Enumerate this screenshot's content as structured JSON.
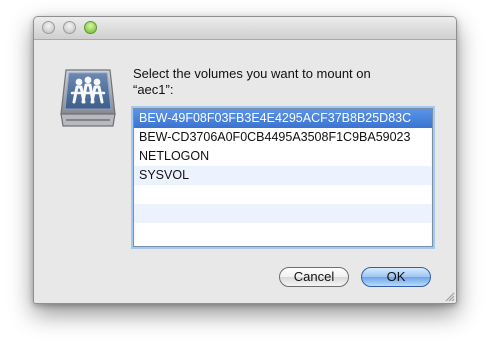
{
  "window": {
    "controls": {
      "close_icon": "close-icon",
      "minimize_icon": "minimize-icon",
      "zoom_icon": "zoom-icon"
    }
  },
  "dialog": {
    "icon": "network-volume-icon",
    "message_line1": "Select the volumes you want to mount on",
    "message_line2": "“aec1”:",
    "volumes": [
      "BEW-49F08F03FB3E4E4295ACF37B8B25D83C",
      "BEW-CD3706A0F0CB4495A3508F1C9BA59023",
      "NETLOGON",
      "SYSVOL",
      "",
      "",
      ""
    ],
    "selected_volume": "BEW-49F08F03FB3E4E4295ACF37B8B25D83C",
    "buttons": {
      "cancel": "Cancel",
      "ok": "OK"
    }
  },
  "colors": {
    "selection": "#3a74d1",
    "default_button": "#6ea5e6",
    "list_alt_row": "#edf3fe",
    "window_background": "#e8e8e8"
  }
}
